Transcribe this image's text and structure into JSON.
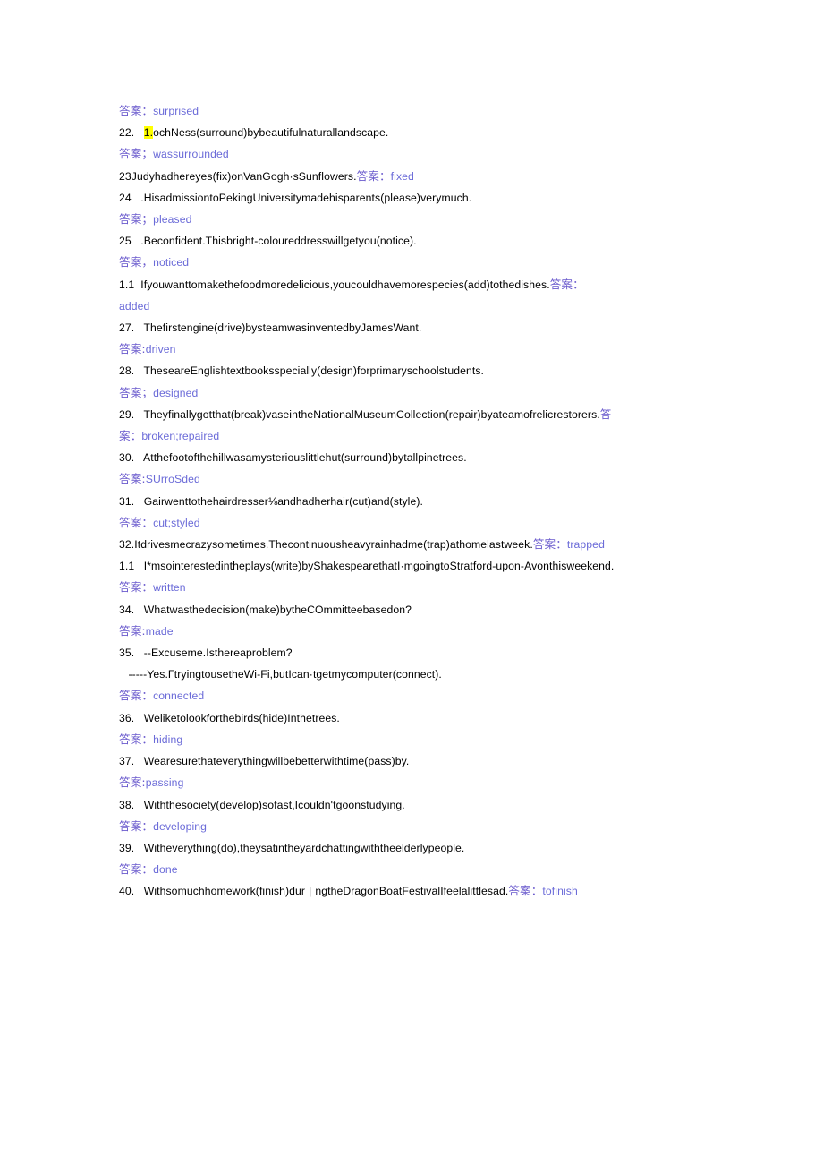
{
  "document": {
    "page_background": "#ffffff",
    "text_color": "#000000",
    "answer_color": "#5b5bd6",
    "answer_label_color": "#6a5acd",
    "highlight_color": "#ffff00",
    "answer_label": "答案"
  },
  "lines": [
    {
      "id": "l01",
      "type": "answer",
      "label": "答案：",
      "value": "surprised"
    },
    {
      "id": "l02",
      "type": "question",
      "num": "22.",
      "highlight": "1.",
      "text": "ochNess(surround)bybeautifulnaturallandscape."
    },
    {
      "id": "l03",
      "type": "answer",
      "label": "答案；",
      "value": "wassurrounded"
    },
    {
      "id": "l04",
      "type": "question_inline",
      "text": "23Judyhadhereyes(fix)onVanGogh·sSunflowers.",
      "label": "答案：",
      "value": "fixed"
    },
    {
      "id": "l05",
      "type": "question",
      "num": "24",
      "text": ".HisadmissiontoPekingUniversitymadehisparents(please)verymuch."
    },
    {
      "id": "l06",
      "type": "answer",
      "label": "答案；",
      "value": "pleased"
    },
    {
      "id": "l07",
      "type": "question",
      "num": "25",
      "text": ".Beconfident.Thisbright-coloureddresswillgetyou(notice)."
    },
    {
      "id": "l08",
      "type": "answer",
      "label": "答案，",
      "value": "noticed"
    },
    {
      "id": "l09",
      "type": "question_inline_wrap",
      "num": "1.1",
      "text": "Ifyouwanttomakethefoodmoredelicious,youcouldhavemorespecies(add)tothedishes.",
      "label": "答案：",
      "value": "added"
    },
    {
      "id": "l10",
      "type": "question",
      "num": "27.",
      "text": "Thefirstengine(drive)bysteamwasinventedbyJamesWant."
    },
    {
      "id": "l11",
      "type": "answer",
      "label": "答案:",
      "value": "driven"
    },
    {
      "id": "l12",
      "type": "question",
      "num": "28.",
      "text": "TheseareEnglishtextbooksspecially(design)forprimaryschoolstudents."
    },
    {
      "id": "l13",
      "type": "answer",
      "label": "答案；",
      "value": "designed"
    },
    {
      "id": "l14",
      "type": "question_inline_wrap2",
      "num": "29.",
      "text": "Theyfinallygotthat(break)vaseintheNationalMuseumCollection(repair)byateamofrelicrestorers.",
      "label_head": "答",
      "label_tail": "案：",
      "value": "broken;repaired"
    },
    {
      "id": "l15",
      "type": "question",
      "num": "30.",
      "text": "Atthefootofthehillwasamysteriouslittlehut(surround)bytallpinetrees."
    },
    {
      "id": "l16",
      "type": "answer",
      "label": "答案:",
      "value": "SUrroSded"
    },
    {
      "id": "l17",
      "type": "question",
      "num": "31.",
      "text": "Gairwenttothehairdresser⅛andhadherhair(cut)and(style)."
    },
    {
      "id": "l18",
      "type": "answer",
      "label": "答案：",
      "value": "cut;styled"
    },
    {
      "id": "l19",
      "type": "question_inline",
      "text": "32.Itdrivesmecrazysometimes.Thecontinuousheavyrainhadme(trap)athomelastweek.",
      "label": "答案：",
      "value": "trapped"
    },
    {
      "id": "l20",
      "type": "question",
      "num": "1.1",
      "text": "I*msointerestedintheplays(write)byShakespearethatI·mgoingtoStratford-upon-Avonthisweekend."
    },
    {
      "id": "l21",
      "type": "answer",
      "label": "答案：",
      "value": "written"
    },
    {
      "id": "l22",
      "type": "question",
      "num": "34.",
      "text": "Whatwasthedecision(make)bytheCOmmitteebasedon?"
    },
    {
      "id": "l23",
      "type": "answer",
      "label": "答案:",
      "value": "made"
    },
    {
      "id": "l24",
      "type": "question",
      "num": "35.",
      "text": "--Excuseme.Isthereaproblem?"
    },
    {
      "id": "l25",
      "type": "question_sub",
      "text": "-----Yes.ΓtryingtousetheWi-Fi,butIcan·tgetmycomputer(connect)."
    },
    {
      "id": "l26",
      "type": "answer",
      "label": "答案：",
      "value": "connected"
    },
    {
      "id": "l27",
      "type": "question",
      "num": "36.",
      "text": "Weliketolookforthebirds(hide)Inthetrees."
    },
    {
      "id": "l28",
      "type": "answer",
      "label": "答案：",
      "value": "hiding"
    },
    {
      "id": "l29",
      "type": "question",
      "num": "37.",
      "text": "Wearesurethateverythingwillbebetterwithtime(pass)by."
    },
    {
      "id": "l30",
      "type": "answer",
      "label": "答案:",
      "value": "passing"
    },
    {
      "id": "l31",
      "type": "question",
      "num": "38.",
      "text": "Withthesociety(develop)sofast,Icouldn'tgoonstudying."
    },
    {
      "id": "l32",
      "type": "answer",
      "label": "答案：",
      "value": "developing"
    },
    {
      "id": "l33",
      "type": "question",
      "num": "39.",
      "text": "Witheverything(do),theysatintheyardchattingwiththeelderlypeople."
    },
    {
      "id": "l34",
      "type": "answer",
      "label": "答案：",
      "value": "done"
    },
    {
      "id": "l35",
      "type": "question_inline_bar",
      "num": "40.",
      "text_a": "Withsomuchhomework(finish)dur",
      "bar": "|",
      "text_b": "ngtheDragonBoatFestivalIfeelalittlesad.",
      "label": "答案：",
      "value": "tofinish"
    }
  ]
}
